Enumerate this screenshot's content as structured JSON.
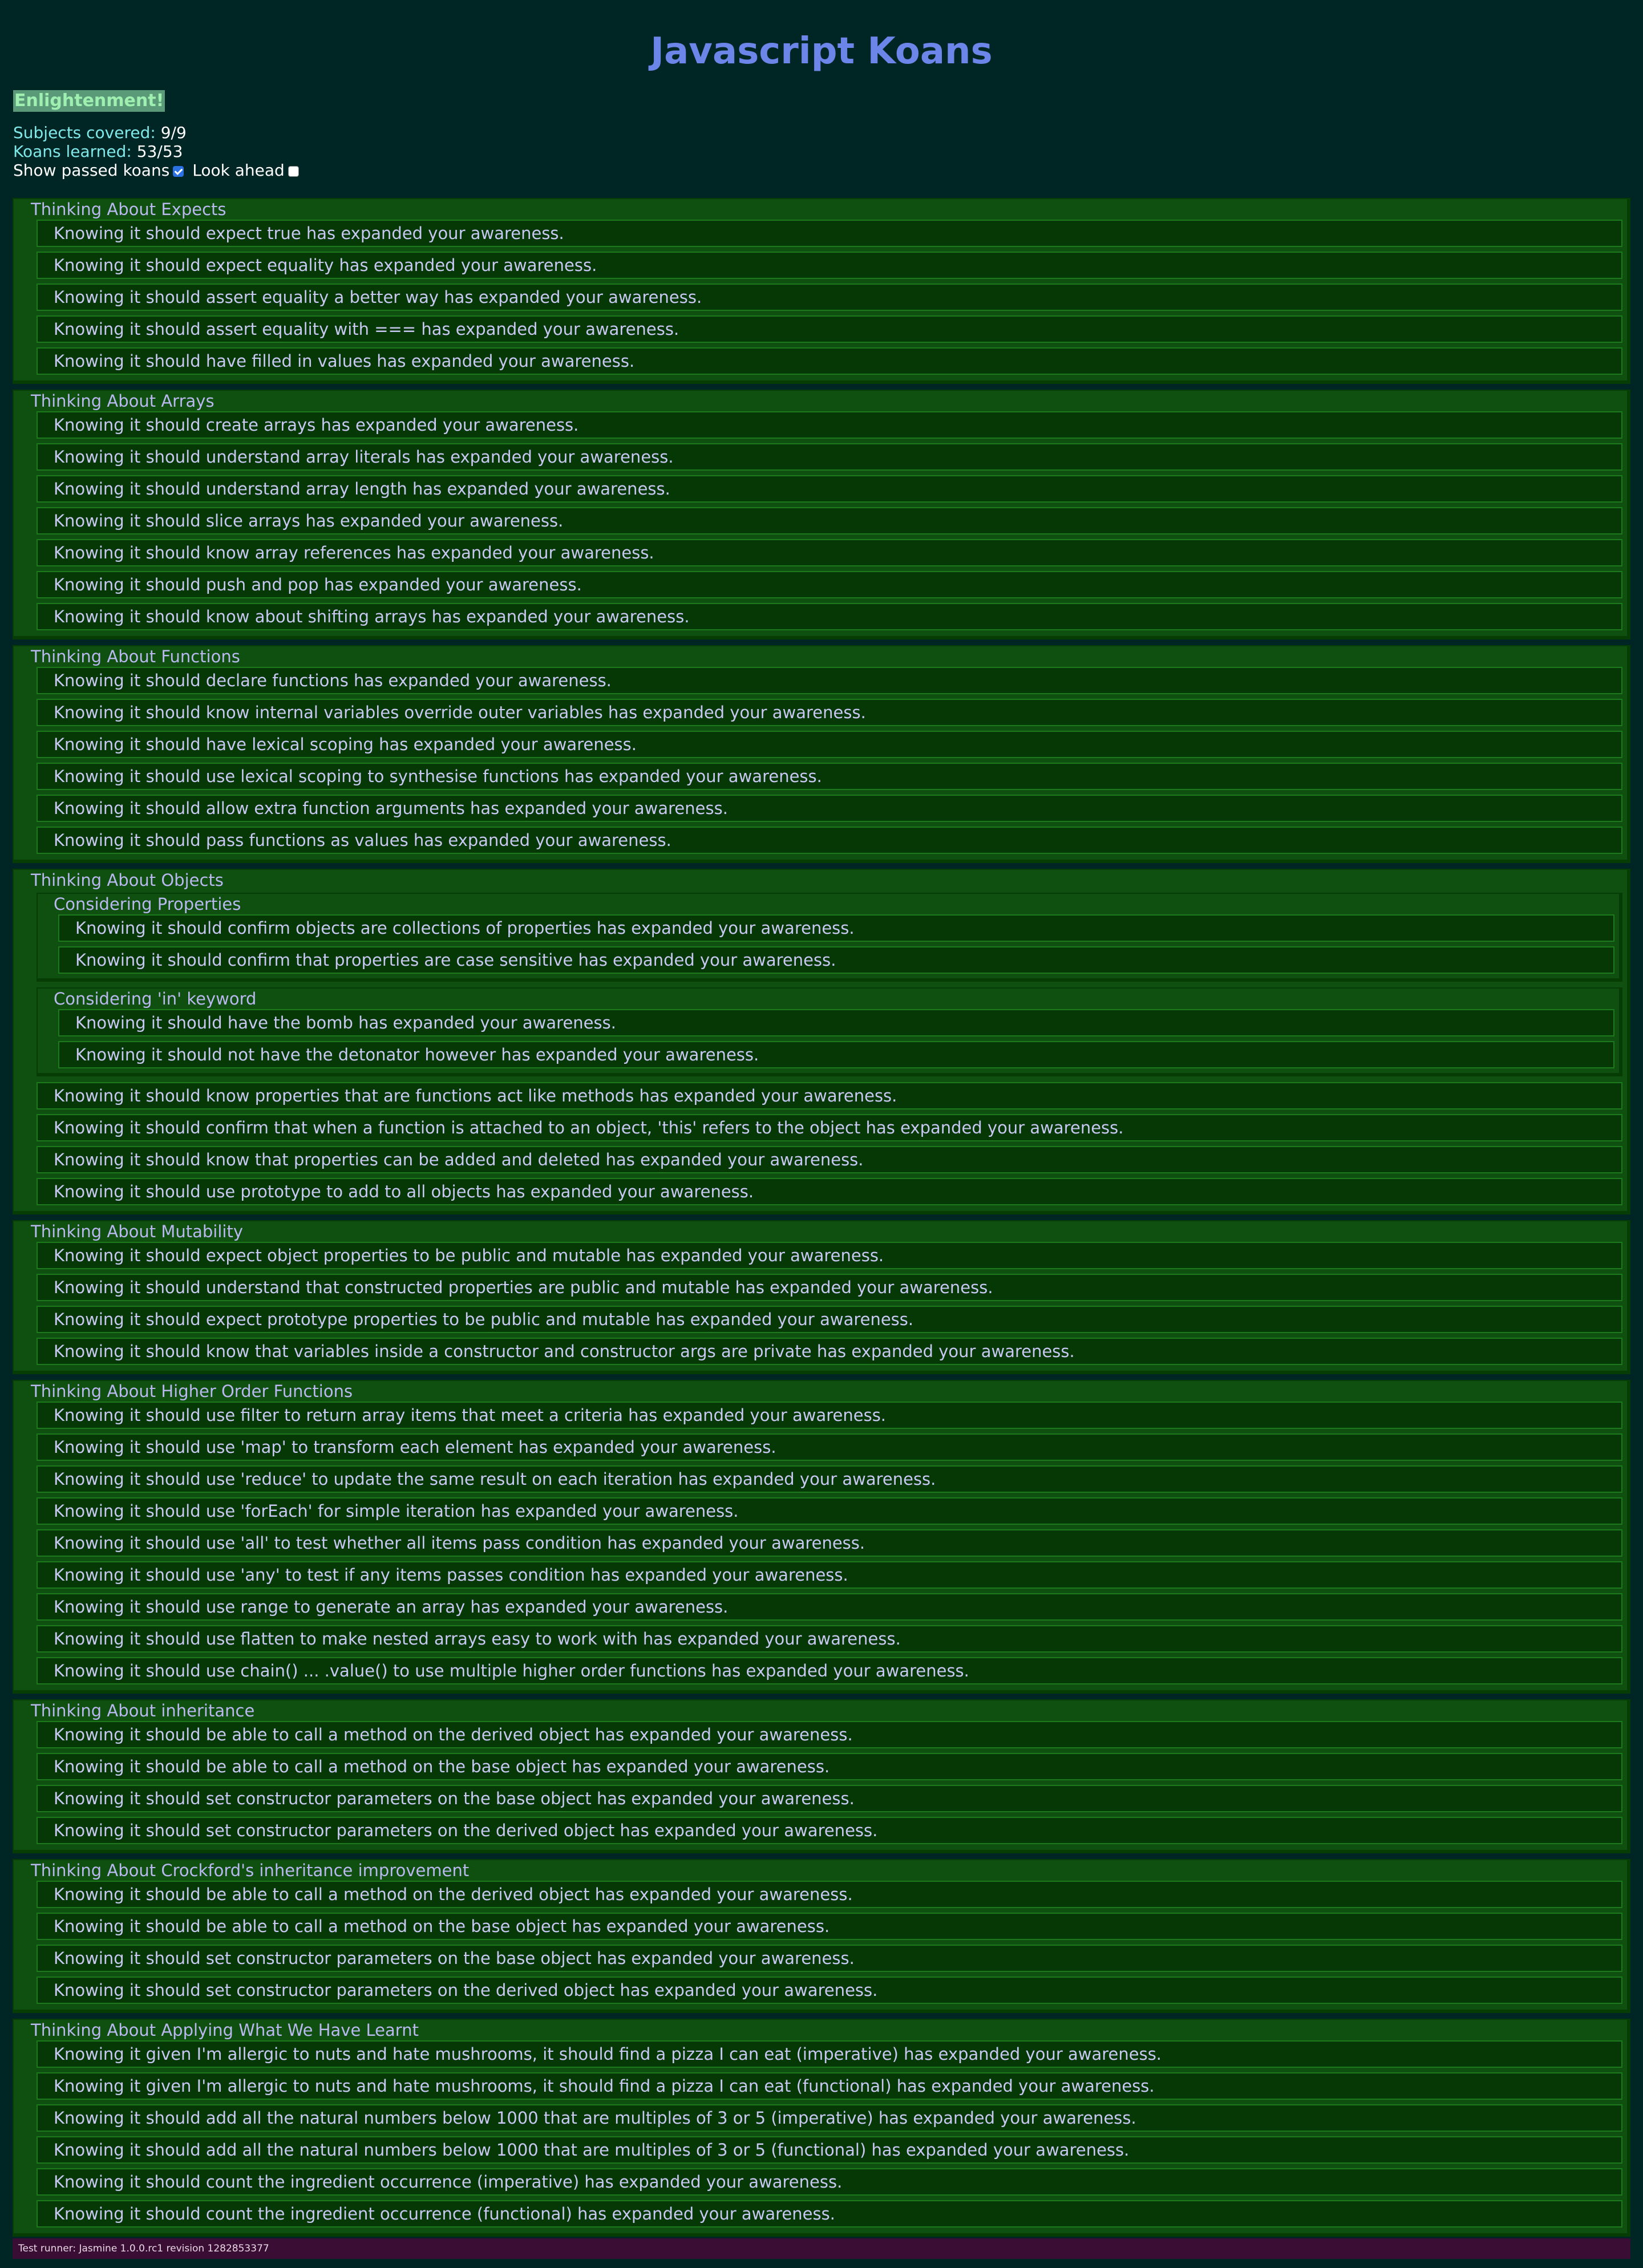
{
  "header": {
    "title": "Javascript Koans",
    "status": "Enlightenment!",
    "subjects_label": "Subjects covered:",
    "subjects_value": "9/9",
    "koans_label": "Koans learned:",
    "koans_value": "53/53",
    "show_passed_label": "Show passed koans",
    "show_passed_checked": true,
    "look_ahead_label": "Look ahead",
    "look_ahead_checked": false
  },
  "suites": [
    {
      "title": "Thinking About Expects",
      "specs": [
        "Knowing it should expect true has expanded your awareness.",
        "Knowing it should expect equality has expanded your awareness.",
        "Knowing it should assert equality a better way has expanded your awareness.",
        "Knowing it should assert equality with === has expanded your awareness.",
        "Knowing it should have filled in values has expanded your awareness."
      ]
    },
    {
      "title": "Thinking About Arrays",
      "specs": [
        "Knowing it should create arrays has expanded your awareness.",
        "Knowing it should understand array literals has expanded your awareness.",
        "Knowing it should understand array length has expanded your awareness.",
        "Knowing it should slice arrays has expanded your awareness.",
        "Knowing it should know array references has expanded your awareness.",
        "Knowing it should push and pop has expanded your awareness.",
        "Knowing it should know about shifting arrays has expanded your awareness."
      ]
    },
    {
      "title": "Thinking About Functions",
      "specs": [
        "Knowing it should declare functions has expanded your awareness.",
        "Knowing it should know internal variables override outer variables has expanded your awareness.",
        "Knowing it should have lexical scoping has expanded your awareness.",
        "Knowing it should use lexical scoping to synthesise functions has expanded your awareness.",
        "Knowing it should allow extra function arguments has expanded your awareness.",
        "Knowing it should pass functions as values has expanded your awareness."
      ]
    },
    {
      "title": "Thinking About Objects",
      "subsuites": [
        {
          "title": "Considering Properties",
          "specs": [
            "Knowing it should confirm objects are collections of properties has expanded your awareness.",
            "Knowing it should confirm that properties are case sensitive has expanded your awareness."
          ]
        },
        {
          "title": "Considering 'in' keyword",
          "specs": [
            "Knowing it should have the bomb has expanded your awareness.",
            "Knowing it should not have the detonator however has expanded your awareness."
          ]
        }
      ],
      "specs": [
        "Knowing it should know properties that are functions act like methods has expanded your awareness.",
        "Knowing it should confirm that when a function is attached to an object, 'this' refers to the object has expanded your awareness.",
        "Knowing it should know that properties can be added and deleted has expanded your awareness.",
        "Knowing it should use prototype to add to all objects has expanded your awareness."
      ]
    },
    {
      "title": "Thinking About Mutability",
      "specs": [
        "Knowing it should expect object properties to be public and mutable has expanded your awareness.",
        "Knowing it should understand that constructed properties are public and mutable has expanded your awareness.",
        "Knowing it should expect prototype properties to be public and mutable has expanded your awareness.",
        "Knowing it should know that variables inside a constructor and constructor args are private has expanded your awareness."
      ]
    },
    {
      "title": "Thinking About Higher Order Functions",
      "specs": [
        "Knowing it should use filter to return array items that meet a criteria has expanded your awareness.",
        "Knowing it should use 'map' to transform each element has expanded your awareness.",
        "Knowing it should use 'reduce' to update the same result on each iteration has expanded your awareness.",
        "Knowing it should use 'forEach' for simple iteration has expanded your awareness.",
        "Knowing it should use 'all' to test whether all items pass condition has expanded your awareness.",
        "Knowing it should use 'any' to test if any items passes condition has expanded your awareness.",
        "Knowing it should use range to generate an array has expanded your awareness.",
        "Knowing it should use flatten to make nested arrays easy to work with has expanded your awareness.",
        "Knowing it should use chain() ... .value() to use multiple higher order functions has expanded your awareness."
      ]
    },
    {
      "title": "Thinking About inheritance",
      "specs": [
        "Knowing it should be able to call a method on the derived object has expanded your awareness.",
        "Knowing it should be able to call a method on the base object has expanded your awareness.",
        "Knowing it should set constructor parameters on the base object has expanded your awareness.",
        "Knowing it should set constructor parameters on the derived object has expanded your awareness."
      ]
    },
    {
      "title": "Thinking About Crockford's inheritance improvement",
      "specs": [
        "Knowing it should be able to call a method on the derived object has expanded your awareness.",
        "Knowing it should be able to call a method on the base object has expanded your awareness.",
        "Knowing it should set constructor parameters on the base object has expanded your awareness.",
        "Knowing it should set constructor parameters on the derived object has expanded your awareness."
      ]
    },
    {
      "title": "Thinking About Applying What We Have Learnt",
      "specs": [
        "Knowing it given I'm allergic to nuts and hate mushrooms, it should find a pizza I can eat (imperative) has expanded your awareness.",
        "Knowing it given I'm allergic to nuts and hate mushrooms, it should find a pizza I can eat (functional) has expanded your awareness.",
        "Knowing it should add all the natural numbers below 1000 that are multiples of 3 or 5 (imperative) has expanded your awareness.",
        "Knowing it should add all the natural numbers below 1000 that are multiples of 3 or 5 (functional) has expanded your awareness.",
        "Knowing it should count the ingredient occurrence (imperative) has expanded your awareness.",
        "Knowing it should count the ingredient occurrence (functional) has expanded your awareness."
      ]
    }
  ],
  "footer": {
    "runner": "Test runner: Jasmine   1.0.0.rc1 revision 1282853377"
  }
}
